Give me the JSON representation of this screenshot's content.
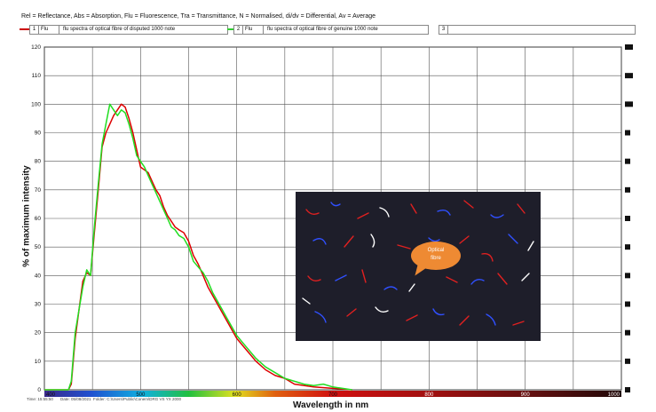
{
  "legend_header": "Rel = Reflectance, Abs = Absorption, Flu = Fluorescence, Tra = Transmittance, N = Normalised, di/dv = Differential, Av = Average",
  "series_boxes": [
    {
      "num": "1",
      "kind": "Flu",
      "desc": "flu spectra of optical fibre of disputed 1000 note",
      "color": "#cc0000"
    },
    {
      "num": "2",
      "kind": "Flu",
      "desc": "flu spectra of optical fibre of genuine 1000 note",
      "color": "#33cc33"
    },
    {
      "num": "3",
      "kind": "",
      "desc": "",
      "color": ""
    }
  ],
  "status": {
    "time": "Time: 15:55:50",
    "date": "Date: 05/08/2021",
    "folder": "Folder: C:\\Users\\Public\\Conem\\DRG VS YX 2000"
  },
  "inset": {
    "callout_line1": "Optical",
    "callout_line2": "fibre"
  },
  "chart_data": {
    "type": "line",
    "xlabel": "Wavelength in nm",
    "ylabel": "% of maximum intensity",
    "xlim": [
      400,
      1000
    ],
    "ylim": [
      0,
      120
    ],
    "xticks": [
      "400",
      "500",
      "600",
      "700",
      "800",
      "900",
      "1000"
    ],
    "yticks": [
      "0",
      "10",
      "20",
      "30",
      "40",
      "50",
      "60",
      "70",
      "80",
      "90",
      "100",
      "110",
      "120"
    ],
    "grid": true,
    "series": [
      {
        "color": "#dd0000",
        "x": [
          400,
          425,
          428,
          432,
          436,
          440,
          444,
          448,
          452,
          456,
          460,
          464,
          468,
          472,
          476,
          480,
          484,
          488,
          492,
          496,
          500,
          504,
          508,
          512,
          516,
          520,
          524,
          528,
          532,
          536,
          540,
          545,
          550,
          555,
          560,
          565,
          570,
          575,
          580,
          585,
          590,
          600,
          610,
          620,
          630,
          640,
          650,
          660,
          680,
          700,
          720
        ],
        "y": [
          0,
          0,
          2,
          18,
          28,
          38,
          41,
          40,
          55,
          70,
          85,
          90,
          93,
          96,
          98,
          100,
          99,
          95,
          90,
          84,
          78,
          77,
          76,
          73,
          70,
          68,
          64,
          61,
          59,
          57,
          56,
          55,
          52,
          47,
          44,
          40,
          36,
          33,
          30,
          27,
          24,
          18,
          14,
          10,
          7,
          5,
          4,
          2,
          1,
          0.5,
          0
        ]
      },
      {
        "color": "#22dd22",
        "x": [
          400,
          425,
          428,
          432,
          436,
          440,
          444,
          448,
          452,
          456,
          460,
          464,
          468,
          472,
          476,
          480,
          484,
          488,
          492,
          496,
          500,
          504,
          508,
          512,
          516,
          520,
          524,
          528,
          532,
          536,
          540,
          545,
          550,
          555,
          560,
          565,
          570,
          575,
          580,
          585,
          590,
          600,
          610,
          620,
          630,
          640,
          650,
          660,
          670,
          680,
          690,
          700,
          710,
          720
        ],
        "y": [
          0,
          0,
          3,
          20,
          28,
          36,
          42,
          40,
          57,
          72,
          86,
          93,
          100,
          98,
          96,
          98,
          97,
          93,
          88,
          82,
          80,
          78,
          75,
          72,
          69,
          66,
          63,
          60,
          57,
          56,
          54,
          53,
          50,
          45,
          43,
          41,
          38,
          34,
          31,
          28,
          25,
          19,
          15,
          11,
          8,
          6,
          4,
          3,
          2,
          1.5,
          2,
          1,
          0.5,
          0
        ]
      }
    ]
  }
}
